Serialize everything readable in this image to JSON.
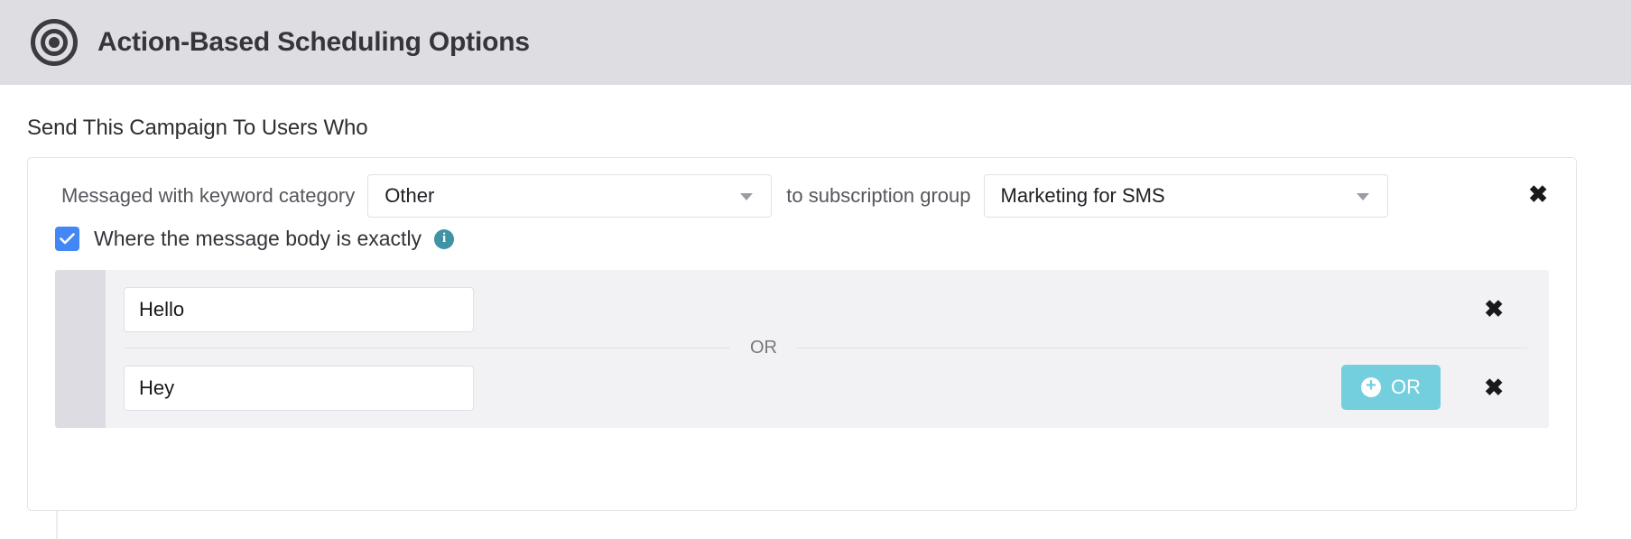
{
  "header": {
    "title": "Action-Based Scheduling Options",
    "icon": "bullseye-icon",
    "background": "#dedee2"
  },
  "section": {
    "label": "Send This Campaign To Users Who"
  },
  "condition": {
    "prefix_label": "Messaged with keyword category",
    "keyword_category": {
      "value": "Other",
      "caret_icon": "chevron-down-icon"
    },
    "middle_label": "to subscription group",
    "subscription_group": {
      "value": "Marketing for SMS",
      "caret_icon": "chevron-down-icon"
    },
    "remove_icon": "close-icon",
    "remove_label": "✖"
  },
  "body_filter": {
    "checked": true,
    "checkbox_icon": "checkmark-icon",
    "label": "Where the message body is exactly",
    "info_icon": "info-icon",
    "info_glyph": "i"
  },
  "or_group": {
    "divider_label": "OR",
    "rows": [
      {
        "value": "Hello",
        "placeholder": "",
        "remove_icon": "close-icon",
        "remove_label": "✖"
      },
      {
        "value": "Hey",
        "placeholder": "",
        "remove_icon": "close-icon",
        "remove_label": "✖"
      }
    ],
    "add_button": {
      "label": "OR",
      "plus_glyph": "+",
      "icon": "plus-circle-icon",
      "color": "#73cfdd"
    }
  },
  "colors": {
    "header_background": "#dedee2",
    "checkbox_blue": "#4287f5",
    "info_teal": "#3f93a4",
    "accent_teal": "#73cfdd",
    "group_panel": "#f2f2f5",
    "group_rail": "#dcdce2"
  }
}
